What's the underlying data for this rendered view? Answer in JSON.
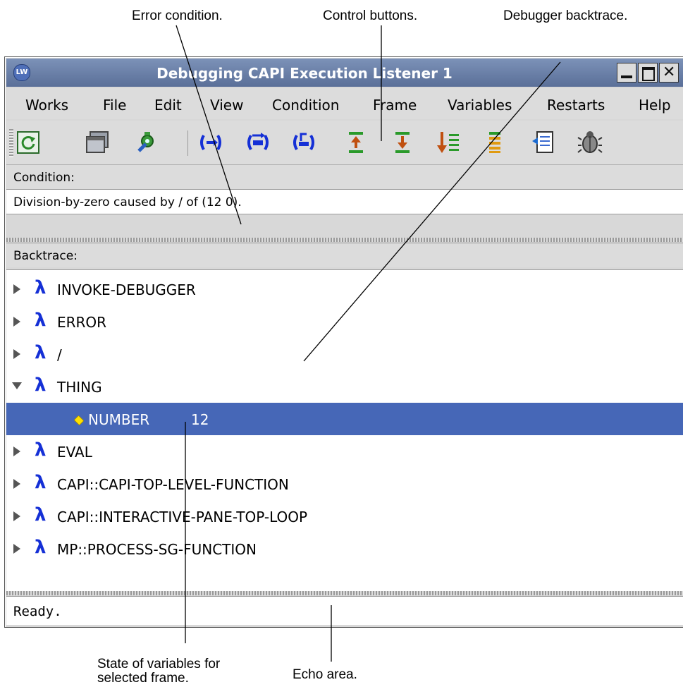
{
  "callouts": {
    "error_condition": "Error condition.",
    "control_buttons": "Control buttons.",
    "debugger_backtrace": "Debugger backtrace.",
    "state_of_variables_line1": "State of variables for",
    "state_of_variables_line2": "selected frame.",
    "echo_area": "Echo area."
  },
  "window": {
    "logo_text": "LW",
    "title": "Debugging CAPI Execution Listener 1"
  },
  "menu": [
    "Works",
    "File",
    "Edit",
    "View",
    "Condition",
    "Frame",
    "Variables",
    "Restarts",
    "Help"
  ],
  "toolbar_icons": [
    "refresh-icon",
    "window-icon",
    "gear-icon",
    "abort-icon",
    "continue-icon",
    "restart-icon",
    "frame-up-icon",
    "frame-down-icon",
    "frame-bottom-icon",
    "frame-top-icon",
    "source-icon",
    "bug-icon"
  ],
  "condition": {
    "label": "Condition:",
    "text": "Division-by-zero caused by / of (12 0)."
  },
  "backtrace": {
    "label": "Backtrace:",
    "frames": [
      {
        "name": "INVOKE-DEBUGGER"
      },
      {
        "name": "ERROR"
      },
      {
        "name": "/"
      },
      {
        "name": "THING",
        "expanded": true
      },
      {
        "name": "EVAL"
      },
      {
        "name": "CAPI::CAPI-TOP-LEVEL-FUNCTION"
      },
      {
        "name": "CAPI::INTERACTIVE-PANE-TOP-LOOP"
      },
      {
        "name": "MP::PROCESS-SG-FUNCTION"
      }
    ],
    "selected_variable": {
      "name": "NUMBER",
      "value": "12"
    },
    "lambda_glyph": "λ"
  },
  "echo_area": {
    "text": "Ready."
  },
  "colors": {
    "selection": "#4667b7",
    "lambda": "#1530d6",
    "titlebar": "#6b80aa"
  }
}
